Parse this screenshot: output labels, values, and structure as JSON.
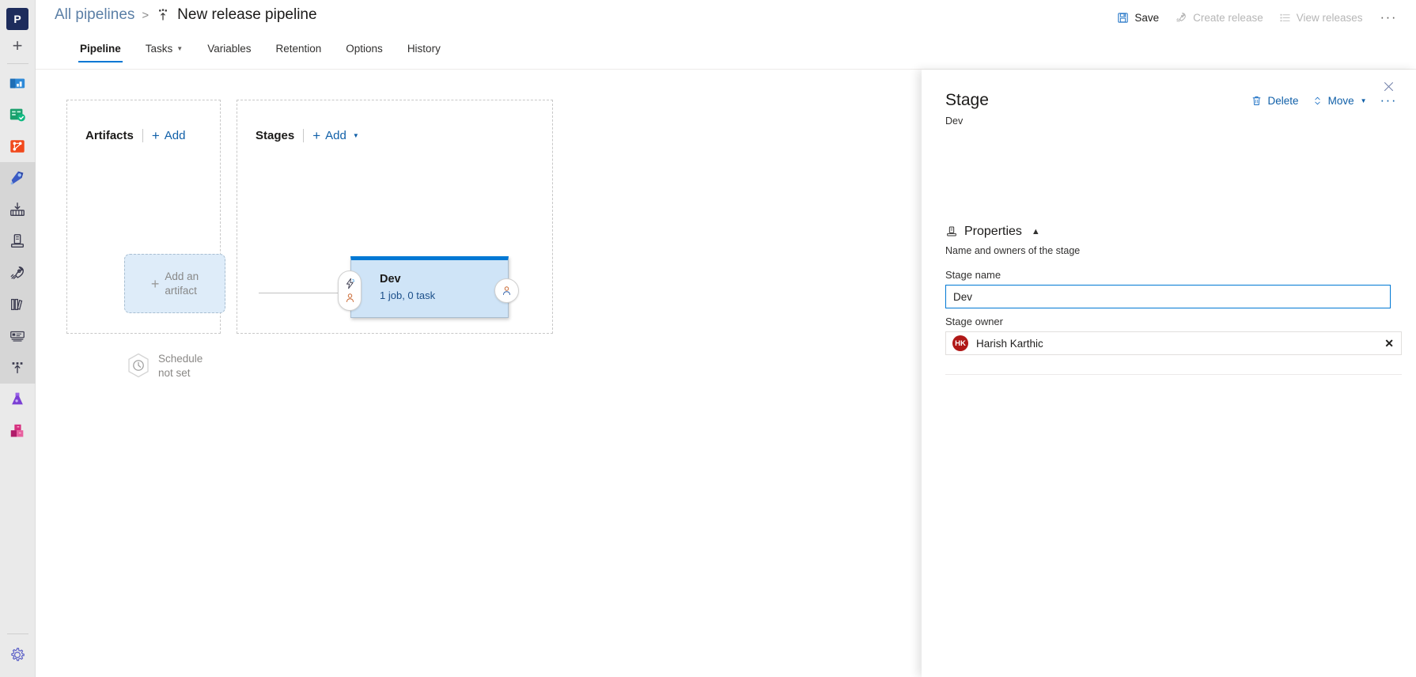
{
  "rail": {
    "project_initial": "P",
    "new_label": "new-item",
    "items": [
      {
        "name": "overview",
        "icon": "overview-icon"
      },
      {
        "name": "boards",
        "icon": "boards-icon"
      },
      {
        "name": "repos",
        "icon": "repos-icon"
      },
      {
        "name": "pipelines",
        "icon": "pipelines-icon"
      },
      {
        "name": "environments",
        "icon": "environments-icon"
      },
      {
        "name": "releases",
        "icon": "releases-icon"
      },
      {
        "name": "deployment-groups",
        "icon": "rocket-icon"
      },
      {
        "name": "library",
        "icon": "library-icon"
      },
      {
        "name": "task-groups",
        "icon": "task-groups-icon"
      },
      {
        "name": "deployment-pools",
        "icon": "deployment-pools-icon"
      },
      {
        "name": "test-plans",
        "icon": "flask-icon"
      },
      {
        "name": "artifacts",
        "icon": "artifacts-icon"
      }
    ],
    "settings_icon": "gear-icon"
  },
  "header": {
    "breadcrumb_root": "All pipelines",
    "breadcrumb_separator": ">",
    "pipeline_icon": "release-pipeline-icon",
    "title": "New release pipeline",
    "tabs": [
      {
        "label": "Pipeline",
        "active": true,
        "has_chevron": false
      },
      {
        "label": "Tasks",
        "active": false,
        "has_chevron": true
      },
      {
        "label": "Variables",
        "active": false,
        "has_chevron": false
      },
      {
        "label": "Retention",
        "active": false,
        "has_chevron": false
      },
      {
        "label": "Options",
        "active": false,
        "has_chevron": false
      },
      {
        "label": "History",
        "active": false,
        "has_chevron": false
      }
    ],
    "actions": [
      {
        "label": "Save",
        "icon": "save-icon",
        "disabled": false
      },
      {
        "label": "Create release",
        "icon": "rocket-icon",
        "disabled": true
      },
      {
        "label": "View releases",
        "icon": "list-icon",
        "disabled": true
      }
    ],
    "overflow": "···"
  },
  "canvas": {
    "artifacts": {
      "title": "Artifacts",
      "add_label": "Add",
      "add_artifact_line1": "Add an",
      "add_artifact_line2": "artifact",
      "schedule_line1": "Schedule",
      "schedule_line2": "not set",
      "schedule_icon": "clock-icon"
    },
    "stages": {
      "title": "Stages",
      "add_label": "Add",
      "stage": {
        "name": "Dev",
        "summary": "1 job, 0 task",
        "pre_icons": [
          "trigger-bolt-icon",
          "person-icon"
        ],
        "post_icon": "person-icon"
      }
    }
  },
  "panel": {
    "title": "Stage",
    "subtitle": "Dev",
    "close_icon": "close-icon",
    "actions": {
      "delete_label": "Delete",
      "delete_icon": "trash-icon",
      "move_label": "Move",
      "move_icon": "move-updown-icon",
      "overflow": "···"
    },
    "properties": {
      "heading": "Properties",
      "heading_icon": "properties-icon",
      "description": "Name and owners of the stage",
      "stage_name_label": "Stage name",
      "stage_name_value": "Dev",
      "stage_name_placeholder": "Stage name",
      "stage_owner_label": "Stage owner",
      "owner_initials": "HK",
      "owner_name": "Harish Karthic",
      "owner_avatar_color": "#b01817",
      "clear_icon": "close-icon",
      "clear_glyph": "✕"
    }
  },
  "colors": {
    "accent": "#0078d4",
    "link": "#0f5fa8",
    "stage_fill": "#cfe4f7",
    "artifact_fill": "#deecf9"
  }
}
